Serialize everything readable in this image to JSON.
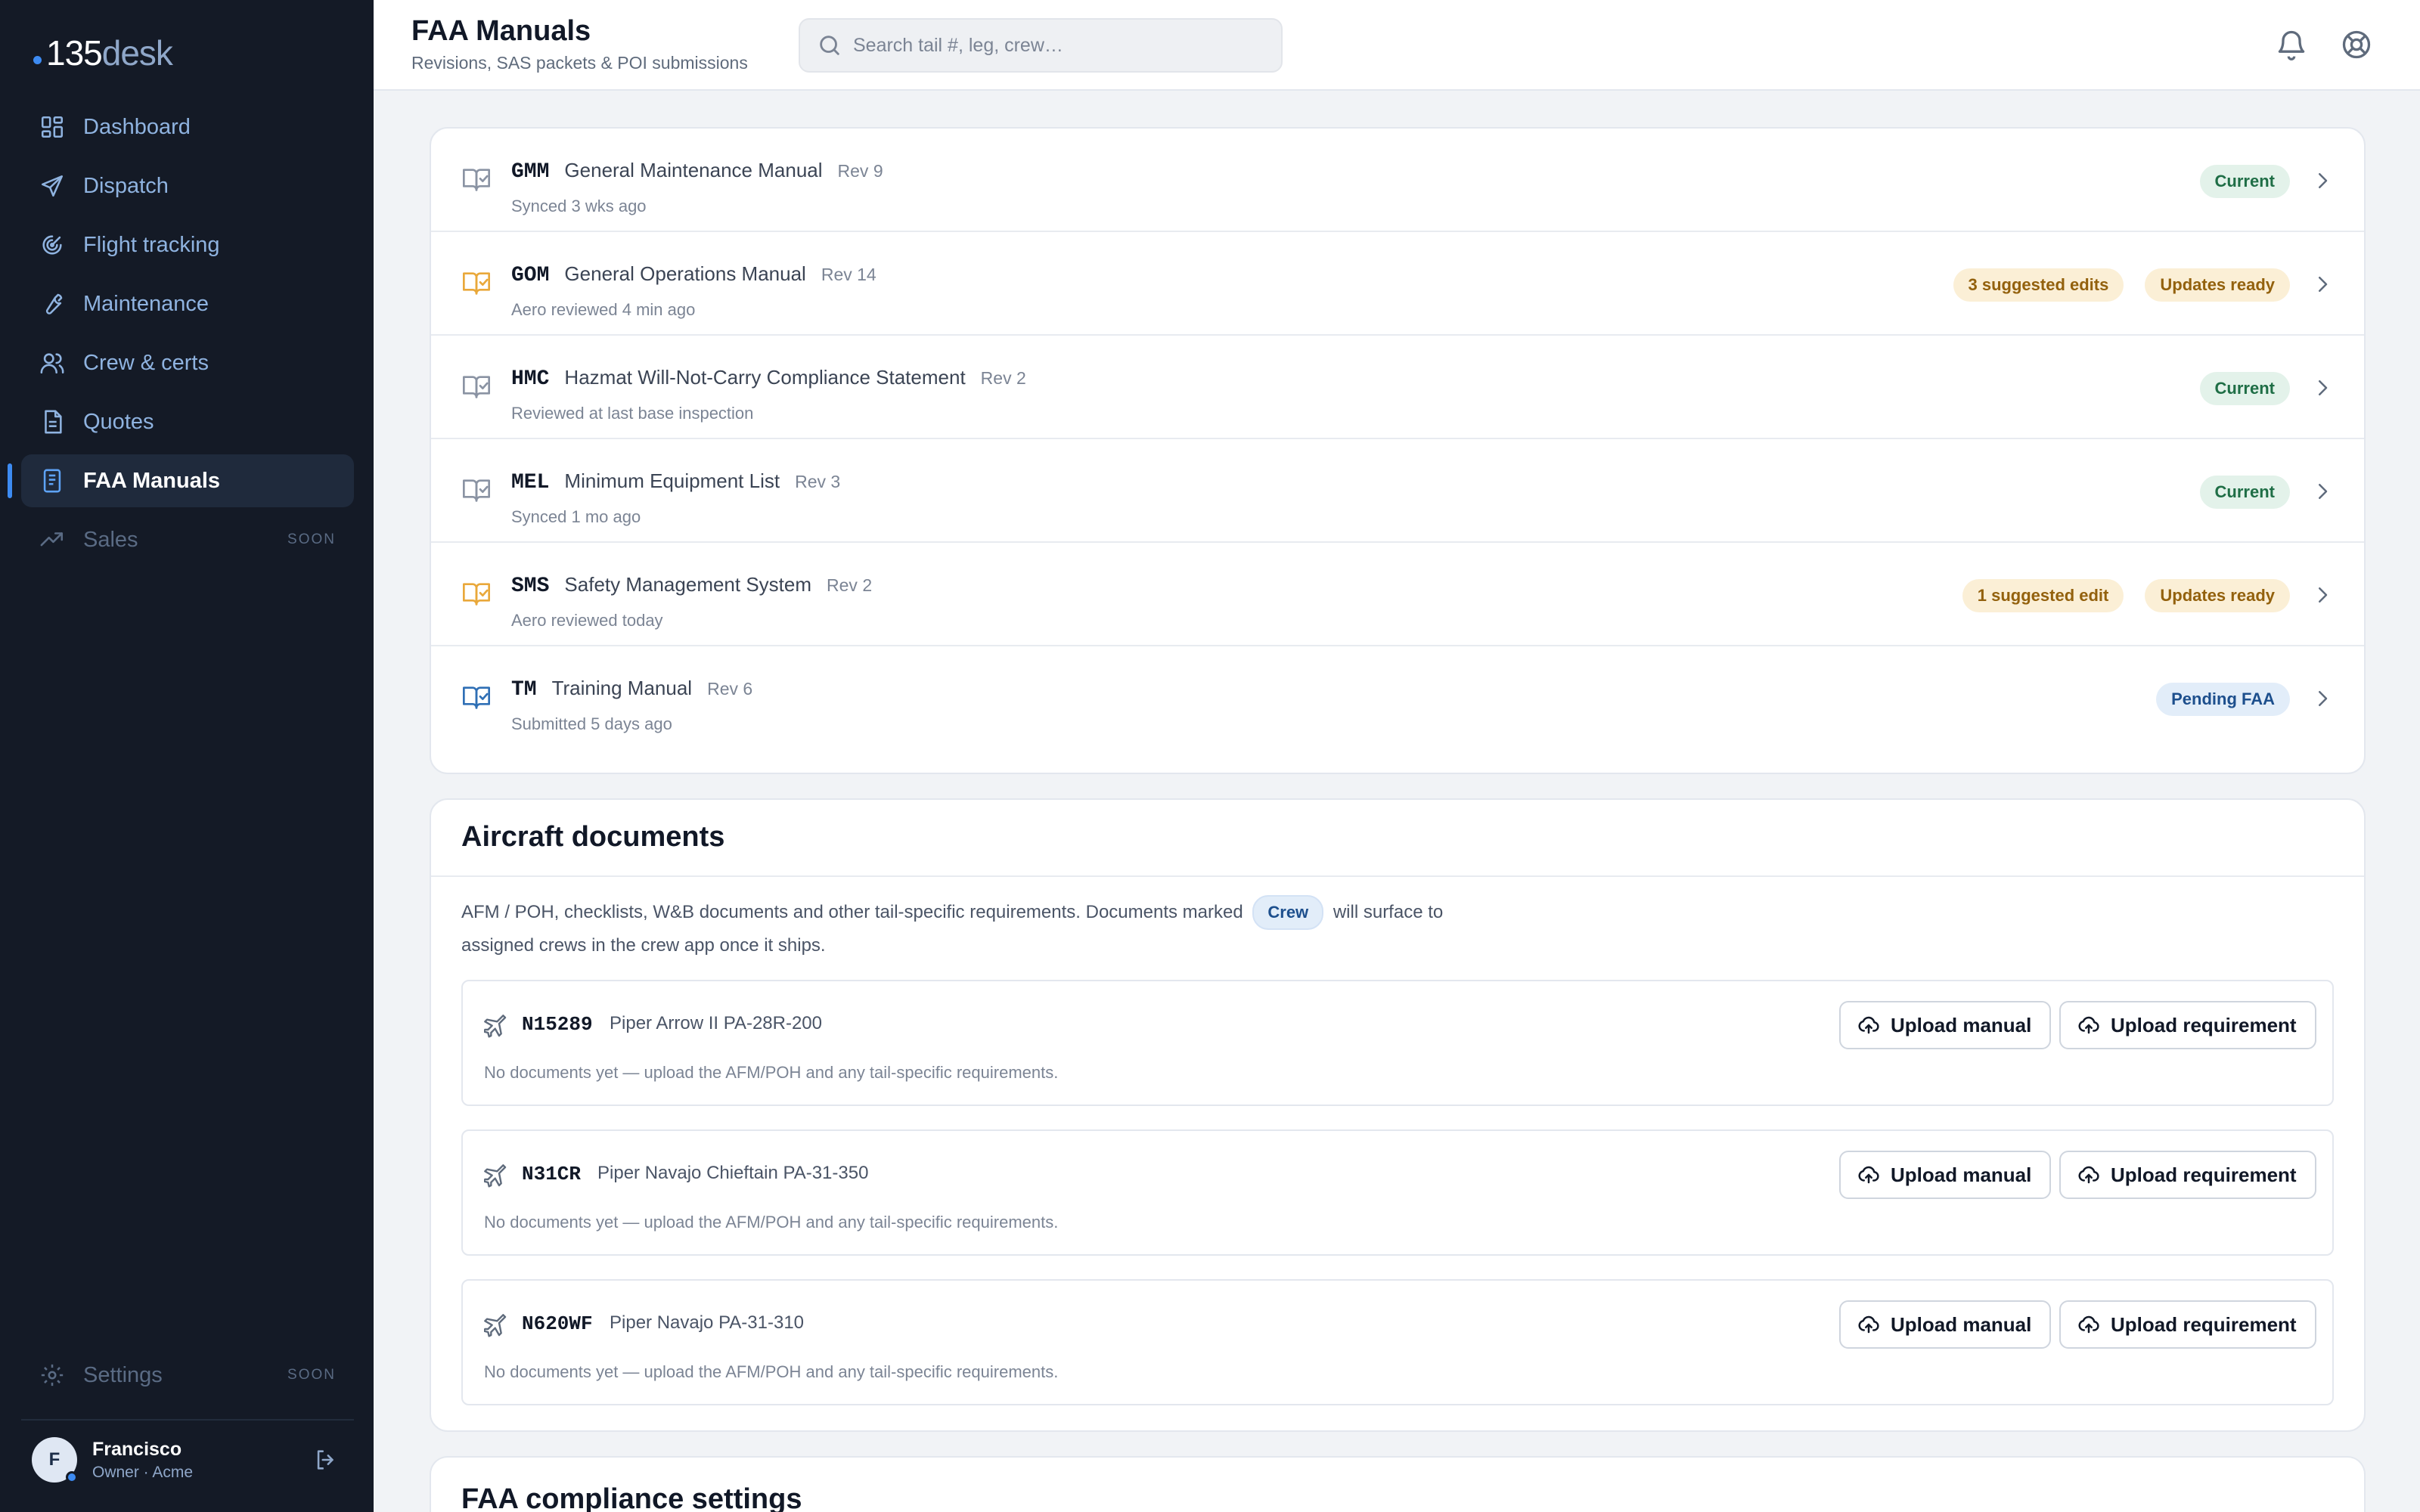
{
  "brand": {
    "number": "135",
    "word": "desk"
  },
  "sidebar": {
    "items": [
      {
        "label": "Dashboard",
        "icon": "dashboard-icon"
      },
      {
        "label": "Dispatch",
        "icon": "send-icon"
      },
      {
        "label": "Flight tracking",
        "icon": "radar-icon"
      },
      {
        "label": "Maintenance",
        "icon": "wrench-icon"
      },
      {
        "label": "Crew & certs",
        "icon": "users-icon"
      },
      {
        "label": "Quotes",
        "icon": "document-icon"
      },
      {
        "label": "FAA Manuals",
        "icon": "book-icon",
        "active": true
      },
      {
        "label": "Sales",
        "icon": "trending-up-icon",
        "badge": "SOON"
      }
    ],
    "settings": {
      "label": "Settings",
      "badge": "SOON",
      "icon": "gear-icon"
    },
    "user": {
      "initial": "F",
      "name": "Francisco",
      "role": "Owner · Acme"
    }
  },
  "header": {
    "title": "FAA Manuals",
    "subtitle": "Revisions, SAS packets & POI submissions",
    "search_placeholder": "Search tail #, leg, crew…"
  },
  "manuals": [
    {
      "code": "GMM",
      "name": "General Maintenance Manual",
      "rev": "Rev  9",
      "meta": "Synced 3 wks ago",
      "badges": [
        {
          "text": "Current",
          "kind": "current"
        }
      ],
      "icon_color": "#8a93a3"
    },
    {
      "code": "GOM",
      "name": "General Operations Manual",
      "rev": "Rev  14",
      "meta": "Aero reviewed 4 min ago",
      "badges": [
        {
          "text": "3 suggested edits",
          "kind": "amber"
        },
        {
          "text": "Updates ready",
          "kind": "amber"
        }
      ],
      "icon_color": "#e9a83a"
    },
    {
      "code": "HMC",
      "name": "Hazmat Will-Not-Carry Compliance Statement",
      "rev": "Rev  2",
      "meta": "Reviewed at last base inspection",
      "badges": [
        {
          "text": "Current",
          "kind": "current"
        }
      ],
      "icon_color": "#8a93a3"
    },
    {
      "code": "MEL",
      "name": "Minimum Equipment List",
      "rev": "Rev  3",
      "meta": "Synced 1 mo ago",
      "badges": [
        {
          "text": "Current",
          "kind": "current"
        }
      ],
      "icon_color": "#8a93a3"
    },
    {
      "code": "SMS",
      "name": "Safety Management System",
      "rev": "Rev  2",
      "meta": "Aero reviewed today",
      "badges": [
        {
          "text": "1 suggested edit",
          "kind": "amber"
        },
        {
          "text": "Updates ready",
          "kind": "amber"
        }
      ],
      "icon_color": "#e9a83a"
    },
    {
      "code": "TM",
      "name": "Training Manual",
      "rev": "Rev  6",
      "meta": "Submitted 5 days ago",
      "badges": [
        {
          "text": "Pending FAA",
          "kind": "pending"
        }
      ],
      "icon_color": "#2f6fb5"
    }
  ],
  "aircraft_section": {
    "title": "Aircraft documents",
    "desc_before": "AFM / POH, checklists, W&B documents and other tail-specific requirements. Documents marked",
    "chip": "Crew",
    "desc_after": "will surface to assigned crews in the crew app once it ships.",
    "upload_manual_label": "Upload manual",
    "upload_requirement_label": "Upload requirement",
    "empty_text": "No documents yet — upload the AFM/POH and any tail-specific requirements.",
    "aircraft": [
      {
        "tail": "N15289",
        "model": "Piper Arrow II PA-28R-200"
      },
      {
        "tail": "N31CR",
        "model": "Piper Navajo Chieftain PA-31-350"
      },
      {
        "tail": "N620WF",
        "model": "Piper Navajo PA-31-310"
      }
    ]
  },
  "compliance_section": {
    "title": "FAA compliance settings"
  },
  "colors": {
    "accent": "#3d8bf2",
    "sidebar_bg": "#141a26",
    "current": "#1f6e46",
    "amber": "#93610d",
    "pending": "#1d4f8d"
  }
}
